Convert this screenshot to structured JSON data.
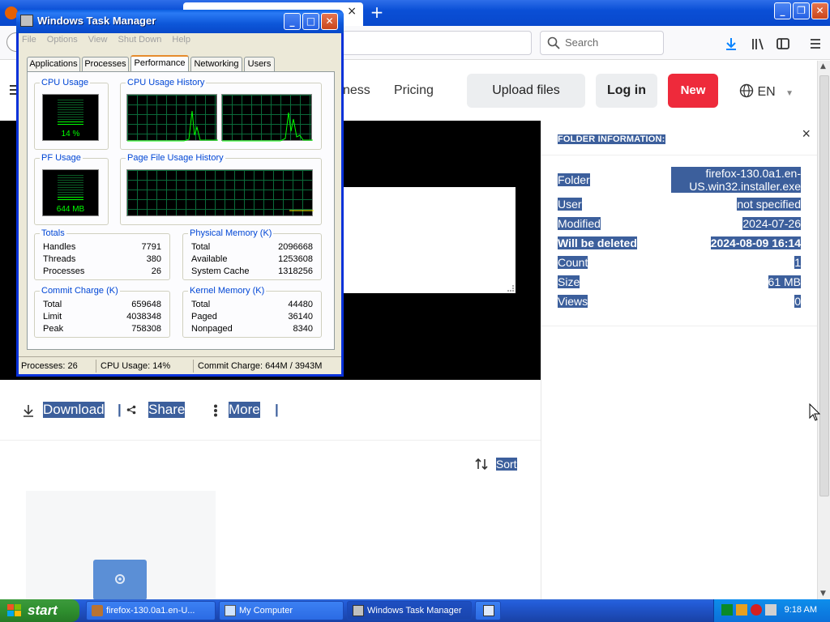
{
  "browser": {
    "search_placeholder": "Search",
    "tab_close": "×",
    "new_tab": "+",
    "scroll_up": "▲",
    "scroll_down": "▼"
  },
  "site_header": {
    "nav_partial": "ness",
    "pricing": "Pricing",
    "upload": "Upload files",
    "login": "Log in",
    "new": "New",
    "language": "EN"
  },
  "actions": {
    "download": "Download",
    "share": "Share",
    "more": "More",
    "sort": "Sort"
  },
  "folder_info": {
    "title": "FOLDER INFORMATION:",
    "close": "×",
    "rows": [
      {
        "label": "Folder",
        "value": "firefox-130.0a1.en-US.win32.installer.exe"
      },
      {
        "label": "User",
        "value": "not specified"
      },
      {
        "label": "Modified",
        "value": "2024-07-26"
      },
      {
        "label": "Will be deleted",
        "value": "2024-08-09 16:14"
      },
      {
        "label": "Count",
        "value": "1"
      },
      {
        "label": "Size",
        "value": "61 MB"
      },
      {
        "label": "Views",
        "value": "0"
      }
    ]
  },
  "task_manager": {
    "title": "Windows Task Manager",
    "menu": [
      "File",
      "Options",
      "View",
      "Shut Down",
      "Help"
    ],
    "tabs": [
      "Applications",
      "Processes",
      "Performance",
      "Networking",
      "Users"
    ],
    "active_tab": "Performance",
    "cpu_usage_label": "CPU Usage",
    "cpu_usage_value": "14 %",
    "cpu_usage_fraction": 0.14,
    "cpu_history_label": "CPU Usage History",
    "pf_usage_label": "PF Usage",
    "pf_usage_value": "644 MB",
    "pf_usage_fraction": 0.16,
    "pf_history_label": "Page File Usage History",
    "totals": {
      "label": "Totals",
      "rows": [
        {
          "k": "Handles",
          "v": "7791"
        },
        {
          "k": "Threads",
          "v": "380"
        },
        {
          "k": "Processes",
          "v": "26"
        }
      ]
    },
    "physical_memory": {
      "label": "Physical Memory (K)",
      "rows": [
        {
          "k": "Total",
          "v": "2096668"
        },
        {
          "k": "Available",
          "v": "1253608"
        },
        {
          "k": "System Cache",
          "v": "1318256"
        }
      ]
    },
    "commit_charge": {
      "label": "Commit Charge (K)",
      "rows": [
        {
          "k": "Total",
          "v": "659648"
        },
        {
          "k": "Limit",
          "v": "4038348"
        },
        {
          "k": "Peak",
          "v": "758308"
        }
      ]
    },
    "kernel_memory": {
      "label": "Kernel Memory (K)",
      "rows": [
        {
          "k": "Total",
          "v": "44480"
        },
        {
          "k": "Paged",
          "v": "36140"
        },
        {
          "k": "Nonpaged",
          "v": "8340"
        }
      ]
    },
    "status": {
      "processes": "Processes: 26",
      "cpu": "CPU Usage: 14%",
      "commit": "Commit Charge: 644M / 3943M"
    }
  },
  "taskbar": {
    "start": "start",
    "tasks": [
      {
        "label": "firefox-130.0a1.en-U..."
      },
      {
        "label": "My Computer"
      },
      {
        "label": "Windows Task Manager"
      }
    ],
    "clock": "9:18 AM"
  },
  "colors": {
    "accent_red": "#ee2a3b",
    "selection": "#3c5f9c",
    "xp_blue": "#245edb",
    "graph_green": "#00ff00"
  }
}
